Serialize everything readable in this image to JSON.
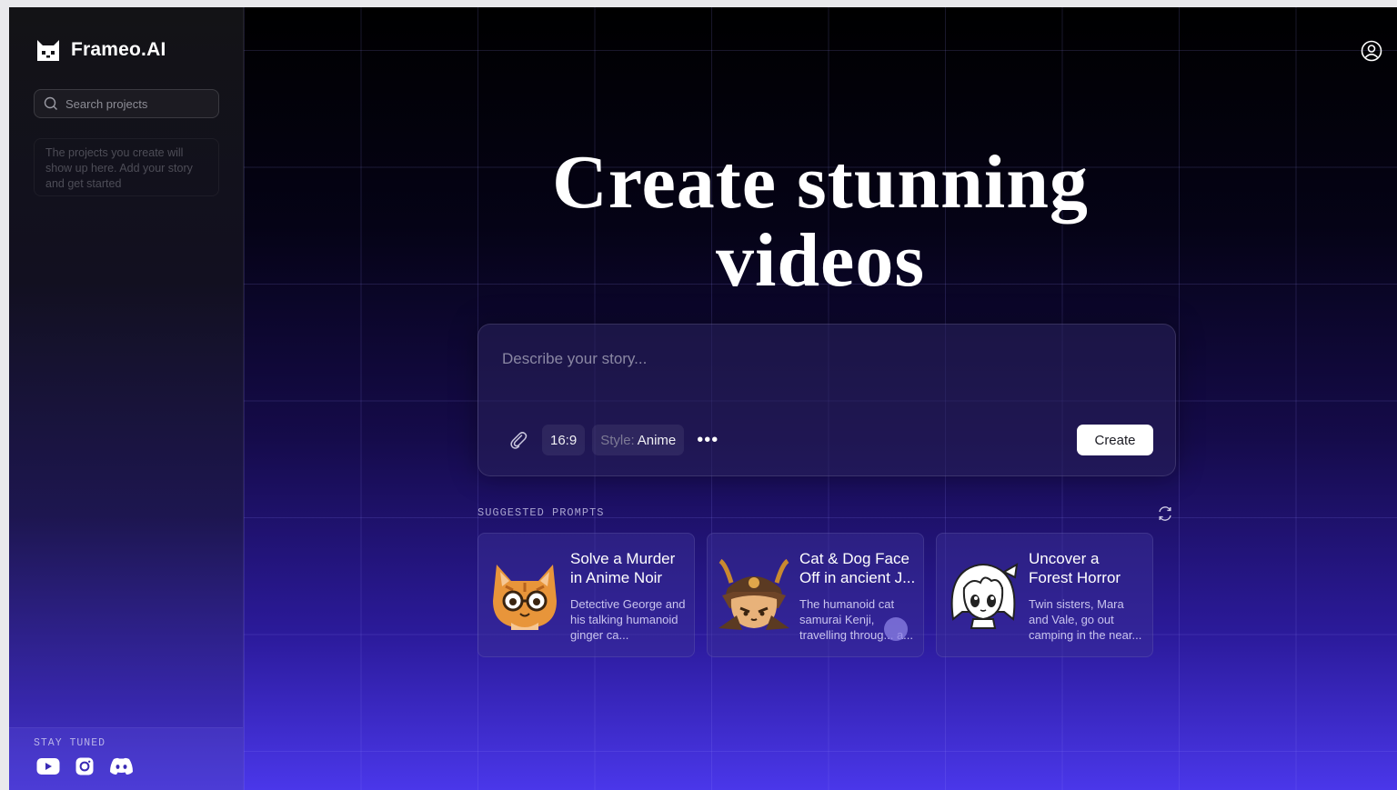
{
  "app": {
    "name": "Frameo.AI"
  },
  "sidebar": {
    "search_placeholder": "Search projects",
    "empty_message": "The projects you create will show up here. Add your story and get started",
    "stay_tuned": "STAY TUNED",
    "socials": [
      "youtube-icon",
      "instagram-icon",
      "discord-icon"
    ]
  },
  "header": {
    "user_icon": "user-circle-icon"
  },
  "hero": {
    "line1": "Create stunning",
    "line2": "videos"
  },
  "prompt": {
    "placeholder": "Describe your story...",
    "aspect_ratio": "16:9",
    "style_label": "Style:",
    "style_value": "Anime",
    "more_label": "•••",
    "create_label": "Create"
  },
  "suggestions": {
    "label": "SUGGESTED PROMPTS",
    "cards": [
      {
        "title": "Solve a Murder in Anime Noir",
        "desc": "Detective George and his talking humanoid ginger ca...",
        "thumb": "ginger-cat-glasses"
      },
      {
        "title": "Cat & Dog Face Off in ancient J...",
        "desc": "The humanoid cat samurai Kenji, travelling throug... a...",
        "thumb": "samurai-cat"
      },
      {
        "title": "Uncover a Forest Horror",
        "desc": "Twin sisters, Mara and Vale, go out camping in the near...",
        "thumb": "anime-girl"
      }
    ]
  },
  "colors": {
    "accent": "#4a37ea",
    "background": "#000000",
    "button": "#ffffff"
  }
}
